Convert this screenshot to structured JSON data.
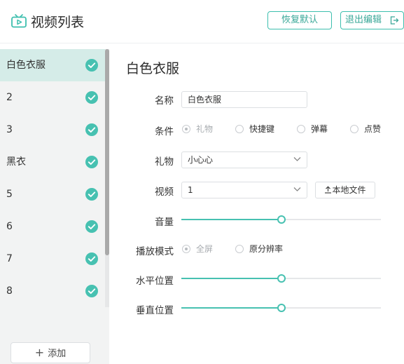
{
  "header": {
    "title": "视频列表",
    "restore_label": "恢复默认",
    "exit_label": "退出编辑"
  },
  "sidebar": {
    "items": [
      {
        "label": "白色衣服",
        "active": true
      },
      {
        "label": "2"
      },
      {
        "label": "3"
      },
      {
        "label": "黑衣"
      },
      {
        "label": "5"
      },
      {
        "label": "6"
      },
      {
        "label": "7"
      },
      {
        "label": "8"
      }
    ],
    "add_label": "添加",
    "add_icon": "plus-icon"
  },
  "form": {
    "title": "白色衣服",
    "name_label": "名称",
    "name_value": "白色衣服",
    "condition_label": "条件",
    "condition_options": [
      "礼物",
      "快捷键",
      "弹幕",
      "点赞"
    ],
    "condition_selected": "礼物",
    "gift_label": "礼物",
    "gift_value": "小心心",
    "video_label": "视频",
    "video_value": "1",
    "local_file_label": "本地文件",
    "volume_label": "音量",
    "volume_value": 0.5,
    "mode_label": "播放模式",
    "mode_options": [
      "全屏",
      "原分辨率"
    ],
    "mode_selected": "全屏",
    "hpos_label": "水平位置",
    "hpos_value": 0.5,
    "vpos_label": "垂直位置",
    "vpos_value": 0.5
  },
  "colors": {
    "accent": "#47c1b1",
    "active_bg": "#d5ece8",
    "sidebar_bg": "#f2f3f3"
  }
}
